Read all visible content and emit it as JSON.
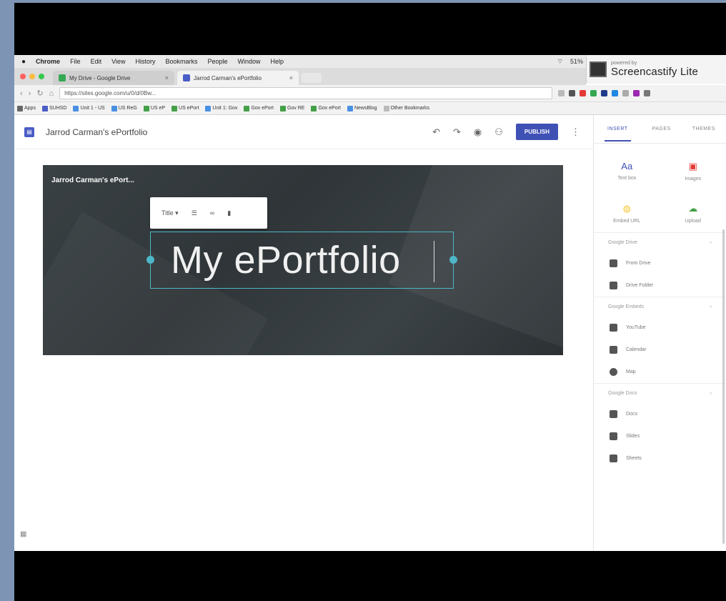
{
  "menubar": {
    "apple": "",
    "items": [
      "Chrome",
      "File",
      "Edit",
      "View",
      "History",
      "Bookmarks",
      "People",
      "Window",
      "Help"
    ],
    "status": "51%"
  },
  "screencastify": {
    "powered": "powered by",
    "name": "Screencastify Lite"
  },
  "tabs": [
    {
      "label": "My Drive - Google Drive",
      "color": "#34a853"
    },
    {
      "label": "Jarrod Carman's ePortfolio",
      "color": "#4a5dc6"
    }
  ],
  "address": {
    "url": "https://sites.google.com/u/0/d/0Bw..."
  },
  "bookmarks": [
    "Apps",
    "SUHSD",
    "Unit 1 - US",
    "US ReG",
    "US eP",
    "US ePort",
    "Unit 1: Gov",
    "Gov ePort",
    "Gov RE",
    "Gov ePort",
    "NewsBlog",
    "Other Bookmarks"
  ],
  "sites": {
    "title": "Jarrod Carman's ePortfolio",
    "publish": "PUBLISH"
  },
  "hero": {
    "site_name": "Jarrod Carman's ePort...",
    "toolbar_style": "Title ▾",
    "title": "My ePortfolio"
  },
  "panel": {
    "tabs": [
      "INSERT",
      "PAGES",
      "THEMES"
    ],
    "grid": [
      {
        "label": "Text box",
        "icon": "Aa",
        "color": "#3f51b5"
      },
      {
        "label": "Images",
        "icon": "▣",
        "color": "#e53935"
      },
      {
        "label": "Embed URL",
        "icon": "◍",
        "color": "#f9c634"
      },
      {
        "label": "Upload",
        "icon": "☁",
        "color": "#43a047"
      }
    ],
    "sections": [
      {
        "title": "Google Drive",
        "items": [
          "From Drive",
          "Drive Folder"
        ]
      },
      {
        "title": "Google Embeds",
        "items": [
          "YouTube",
          "Calendar",
          "Map"
        ]
      },
      {
        "title": "Google Docs",
        "items": [
          "Docs",
          "Slides",
          "Sheets"
        ]
      }
    ]
  }
}
